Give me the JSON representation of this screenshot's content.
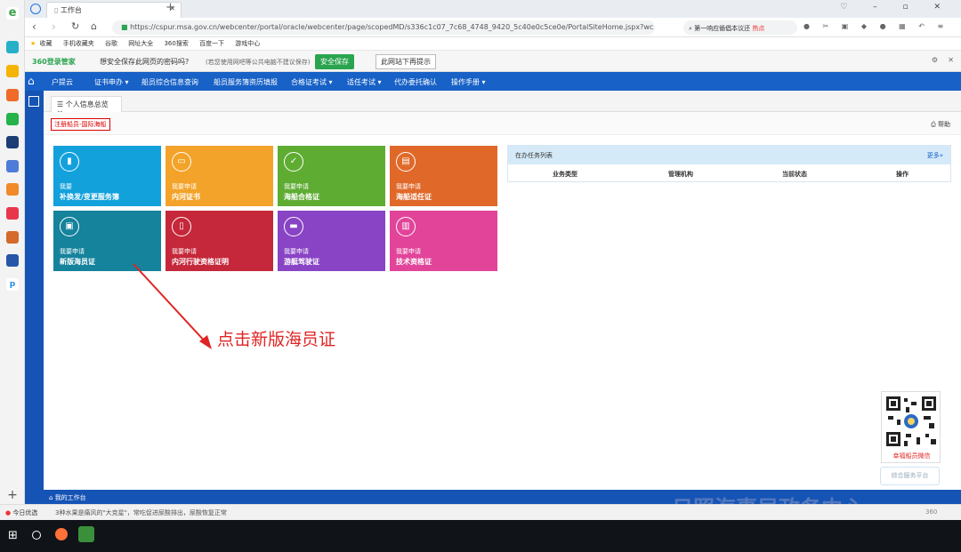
{
  "browser": {
    "tab_title": "工作台",
    "url": "https://cspur.msa.gov.cn/webcenter/portal/oracle/webcenter/page/scopedMD/s336c1c07_7c68_4748_9420_5c40e0c5ce0e/PortalSiteHome.jspx?wc",
    "search_box": "第一响应循倡本议还",
    "search_hot": "热点",
    "bookmarks": [
      "收藏",
      "手机收藏夹",
      "谷歌",
      "网址大全",
      "360搜索",
      "百度一下",
      "游戏中心"
    ]
  },
  "password_bar": {
    "brand": "360登录管家",
    "question": "想安全保存此网页的密码吗?",
    "note": "(若您使用网吧等公共电脑不建议保存)",
    "save_button": "安全保存",
    "never_button": "此网站下再提示"
  },
  "nav": {
    "items": [
      "户提云",
      "证书申办 ▾",
      "船员综合信息查询",
      "船员服务簿资历填报",
      "合格证考试 ▾",
      "适任考试 ▾",
      "代办委托确认",
      "操作手册 ▾"
    ]
  },
  "page_tab": "个人信息总览",
  "red_label": "注册船员-国际海船",
  "help": "帮助",
  "tiles": [
    {
      "small": "我要",
      "big": "补换发/变更服务簿",
      "icon": "bookmark-icon",
      "color": "#13a1dc"
    },
    {
      "small": "我要申请",
      "big": "内河证书",
      "icon": "inbox-icon",
      "color": "#f3a329"
    },
    {
      "small": "我要申请",
      "big": "海船合格证",
      "icon": "checklist-icon",
      "color": "#5fac33"
    },
    {
      "small": "我要申请",
      "big": "海船适任证",
      "icon": "certificate-icon",
      "color": "#e0692a"
    },
    {
      "small": "我要申请",
      "big": "新版海员证",
      "icon": "id-card-icon",
      "color": "#15839c"
    },
    {
      "small": "我要申请",
      "big": "内河行驶资格证明",
      "icon": "document-icon",
      "color": "#c5283a"
    },
    {
      "small": "我要申请",
      "big": "游艇驾驶证",
      "icon": "card-icon",
      "color": "#8944c5"
    },
    {
      "small": "我要申请",
      "big": "技术资格证",
      "icon": "license-icon",
      "color": "#e2449a"
    }
  ],
  "task_panel": {
    "title": "在办任务列表",
    "more": "更多»",
    "columns": [
      "业务类型",
      "管理机构",
      "当前状态",
      "操作"
    ]
  },
  "annotation": "点击新版海员证",
  "qr_caption": "幸福船员微信",
  "service_button": "综合服务平台",
  "bottom_left": "我的工作台",
  "watermark": "日照海事局政务中心",
  "status_items": [
    "今日优选",
    "3种水果是痛风的\"大克星\"，常吃促进尿酸排出，尿酸恢复正常"
  ],
  "statusbar_right": "360"
}
